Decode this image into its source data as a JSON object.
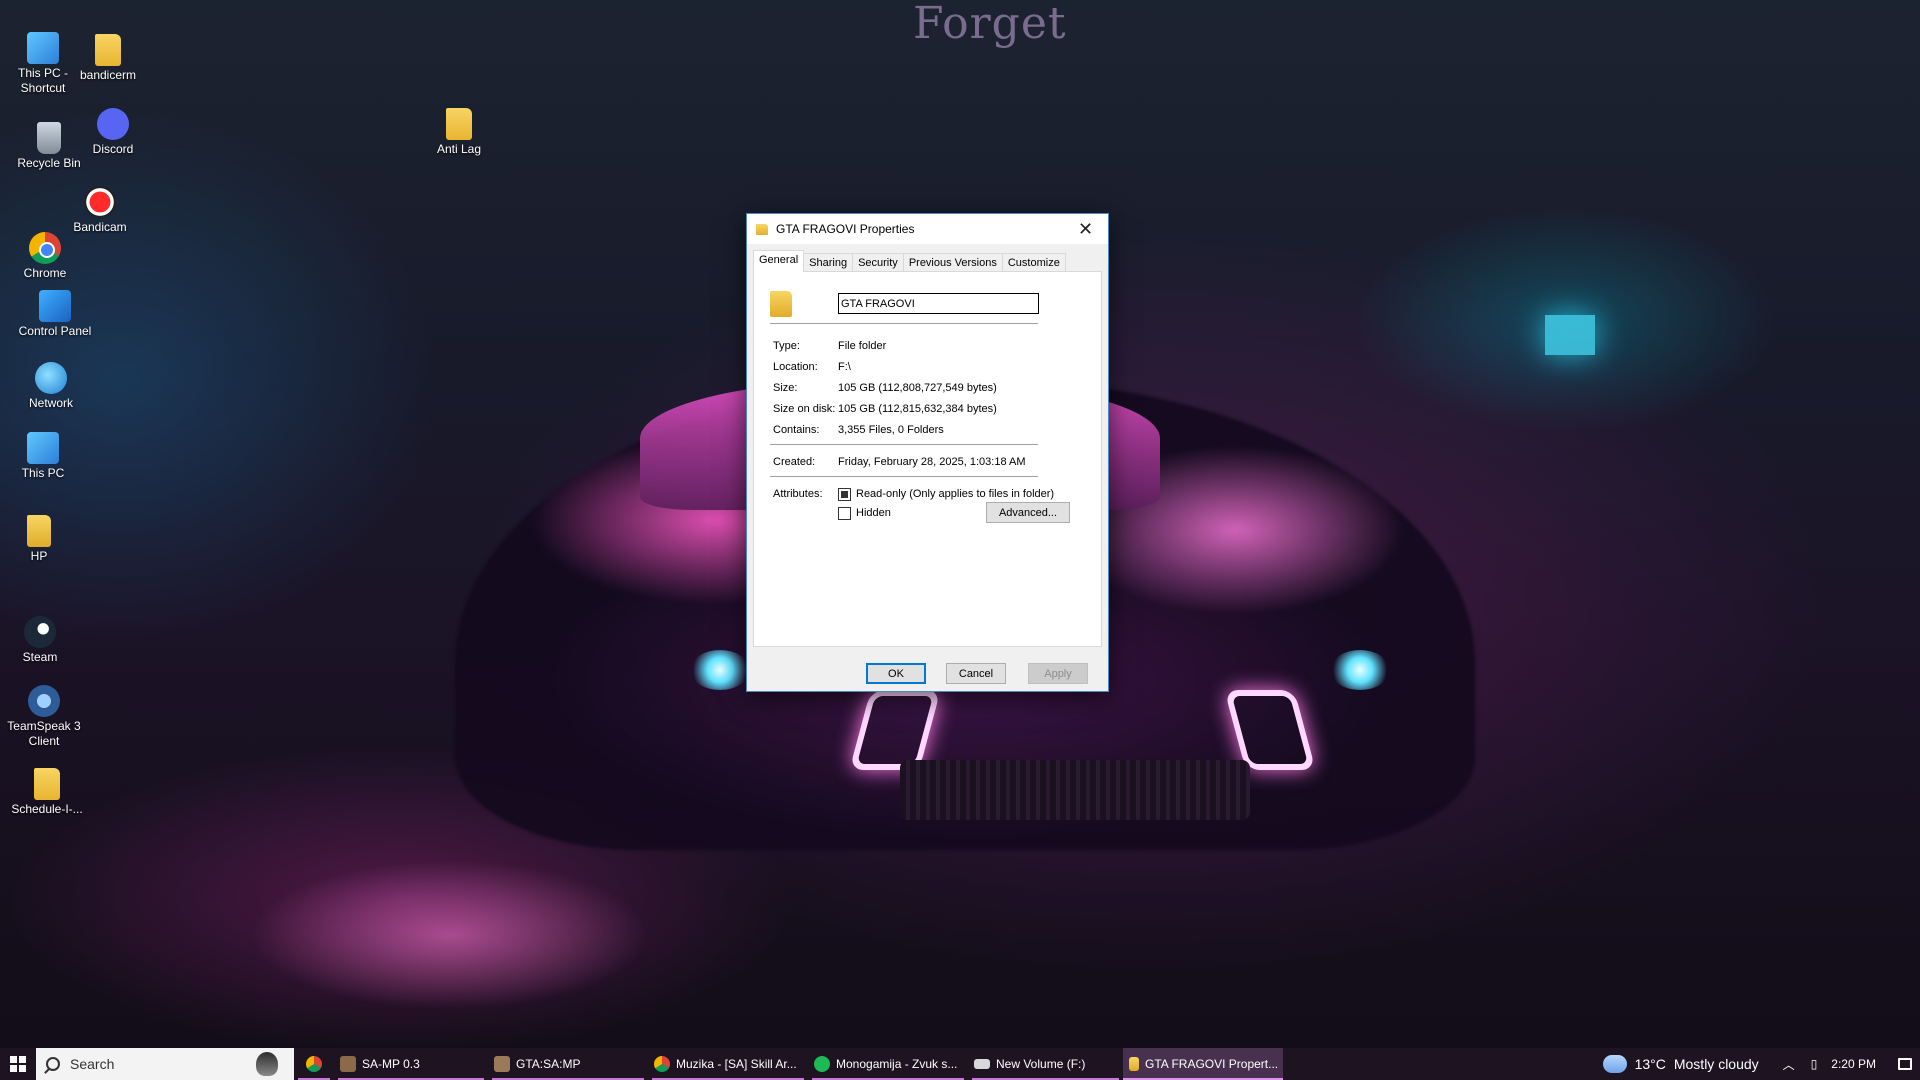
{
  "wallpaper": {
    "text": "Forget"
  },
  "desktop_icons": [
    {
      "label": "This PC - Shortcut",
      "icon": "this-pc-shortcut-icon"
    },
    {
      "label": "bandicerm",
      "icon": "folder-icon"
    },
    {
      "label": "Recycle Bin",
      "icon": "recycle-bin-icon"
    },
    {
      "label": "Discord",
      "icon": "discord-icon"
    },
    {
      "label": "Anti Lag",
      "icon": "folder-icon"
    },
    {
      "label": "Bandicam",
      "icon": "bandicam-icon"
    },
    {
      "label": "Chrome",
      "icon": "chrome-icon"
    },
    {
      "label": "Control Panel",
      "icon": "control-panel-icon"
    },
    {
      "label": "Network",
      "icon": "network-icon"
    },
    {
      "label": "This PC",
      "icon": "this-pc-icon"
    },
    {
      "label": "HP",
      "icon": "user-folder-icon"
    },
    {
      "label": "Steam",
      "icon": "steam-icon"
    },
    {
      "label": "TeamSpeak 3 Client",
      "icon": "teamspeak-icon"
    },
    {
      "label": "Schedule-I-...",
      "icon": "folder-icon"
    }
  ],
  "dialog": {
    "title": "GTA FRAGOVI Properties",
    "close_glyph": "✕",
    "tabs": [
      "General",
      "Sharing",
      "Security",
      "Previous Versions",
      "Customize"
    ],
    "active_tab": "General",
    "name_value": "GTA FRAGOVI",
    "fields": [
      {
        "label": "Type:",
        "value": "File folder"
      },
      {
        "label": "Location:",
        "value": "F:\\"
      },
      {
        "label": "Size:",
        "value": "105 GB (112,808,727,549 bytes)"
      },
      {
        "label": "Size on disk:",
        "value": "105 GB (112,815,632,384 bytes)"
      },
      {
        "label": "Contains:",
        "value": "3,355 Files, 0 Folders"
      },
      {
        "label": "Created:",
        "value": "Friday, February 28, 2025, 1:03:18 AM"
      }
    ],
    "attributes_label": "Attributes:",
    "readonly": {
      "label": "Read-only (Only applies to files in folder)",
      "state": "indeterminate"
    },
    "hidden": {
      "label": "Hidden",
      "state": "unchecked"
    },
    "advanced_button": "Advanced...",
    "ok_button": "OK",
    "cancel_button": "Cancel",
    "apply_button": "Apply"
  },
  "taskbar": {
    "search_placeholder": "Search",
    "apps": [
      {
        "label": "",
        "icon": "chrome-icon",
        "color": "#f4b400"
      },
      {
        "label": "SA-MP 0.3",
        "icon": "samp-icon",
        "color": "#8a6a4a"
      },
      {
        "label": "GTA:SA:MP",
        "icon": "gta-icon",
        "color": "#9a7a5a"
      },
      {
        "label": "Muzika - [SA] Skill Ar...",
        "icon": "chrome-icon",
        "color": "#e64a3a"
      },
      {
        "label": "Monogamija - Zvuk s...",
        "icon": "spotify-icon",
        "color": "#1db954"
      },
      {
        "label": "New Volume (F:)",
        "icon": "file-explorer-icon",
        "color": "#d8d8d8"
      },
      {
        "label": "GTA FRAGOVI Propert...",
        "icon": "folder-icon",
        "color": "#f0c040"
      }
    ],
    "weather": {
      "temp": "13°C",
      "condition": "Mostly cloudy"
    },
    "time": "2:20 PM"
  }
}
